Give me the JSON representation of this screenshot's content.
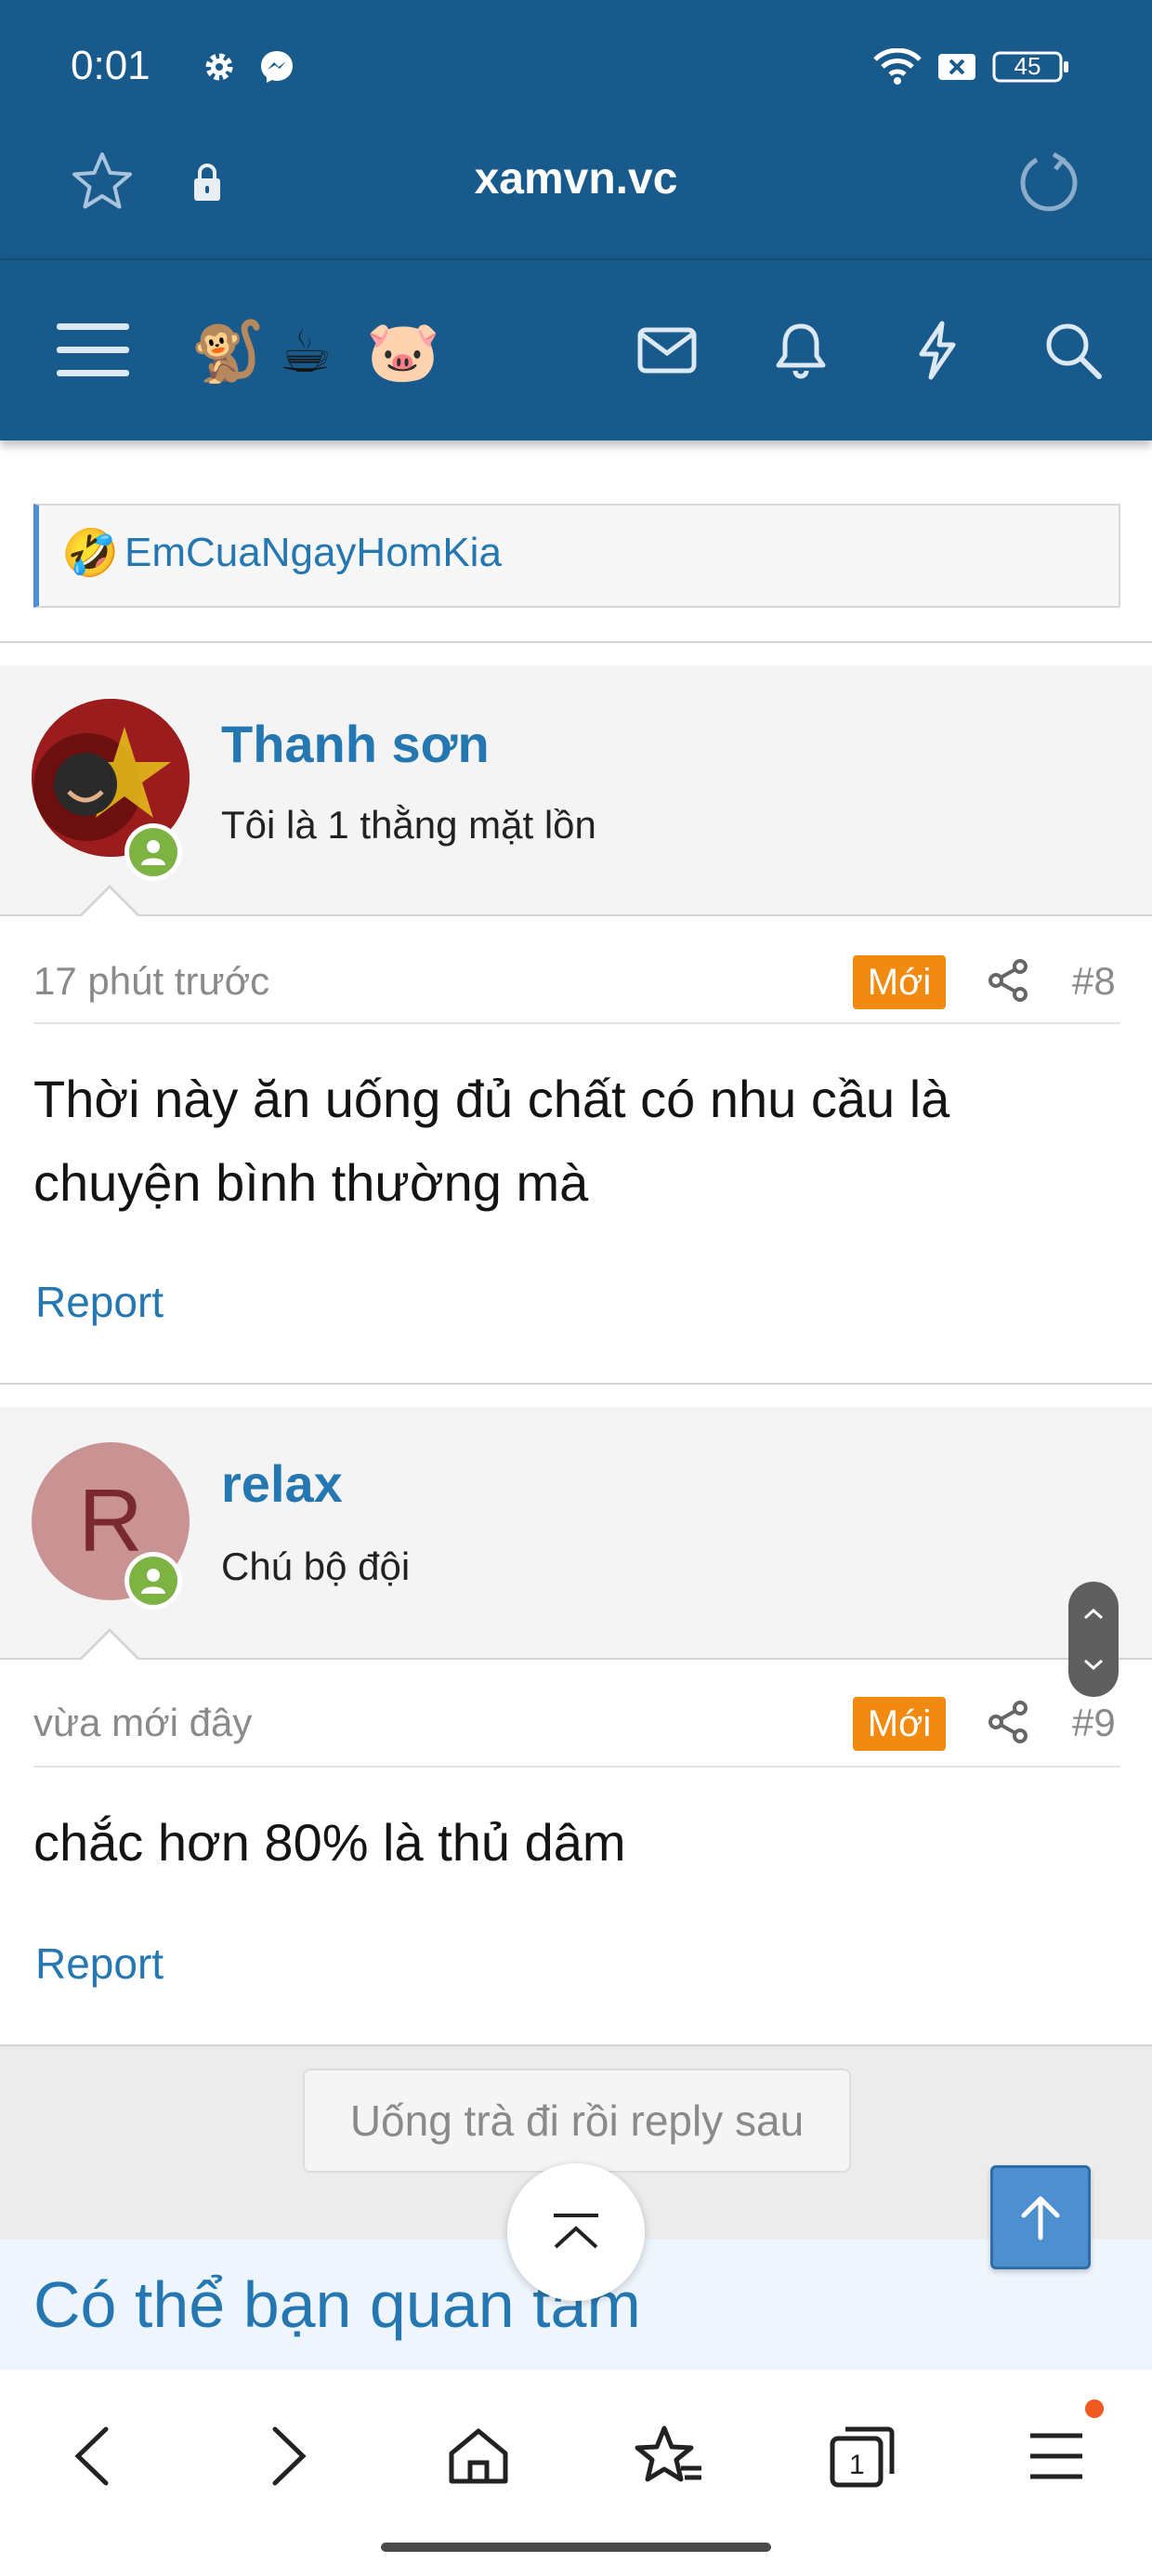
{
  "status_bar": {
    "time": "0:01",
    "battery": "45",
    "icons": [
      "gear-icon",
      "messenger-icon",
      "wifi-icon",
      "sim-off-icon",
      "battery-icon"
    ]
  },
  "browser": {
    "url": "xamvn.vc",
    "icons": [
      "star-icon",
      "lock-icon",
      "reload-icon"
    ]
  },
  "forum_nav": {
    "icons": [
      "menu-icon",
      "mail-icon",
      "bell-icon",
      "lightning-icon",
      "search-icon"
    ],
    "emojis": [
      "🐒",
      "☕",
      "🐷"
    ]
  },
  "quote": {
    "emoji": "🤣",
    "name": "EmCuaNgayHomKia"
  },
  "posts": [
    {
      "username": "Thanh sơn",
      "user_title": "Tôi là 1 thằng mặt lồn",
      "time": "17 phút trước",
      "badge": "Mới",
      "number": "#8",
      "body": "Thời này ăn uống đủ chất có nhu cầu là chuyện bình thường mà",
      "report": "Report"
    },
    {
      "username": "relax",
      "avatar_letter": "R",
      "user_title": "Chú bộ đội",
      "time": "vừa mới đây",
      "badge": "Mới",
      "number": "#9",
      "body": "chắc hơn 80% là thủ dâm",
      "report": "Report"
    }
  ],
  "reply_button": "Uống trà đi rồi reply sau",
  "related_title": "Có thể bạn quan tâm",
  "bottom_nav": {
    "tab_count": "1",
    "icons": [
      "back-icon",
      "forward-icon",
      "home-icon",
      "bookmarks-icon",
      "tabs-icon",
      "menu-icon"
    ]
  },
  "colors": {
    "header": "#185a8c",
    "link": "#2577b1",
    "badge": "#f08a10",
    "online": "#7cb342"
  }
}
